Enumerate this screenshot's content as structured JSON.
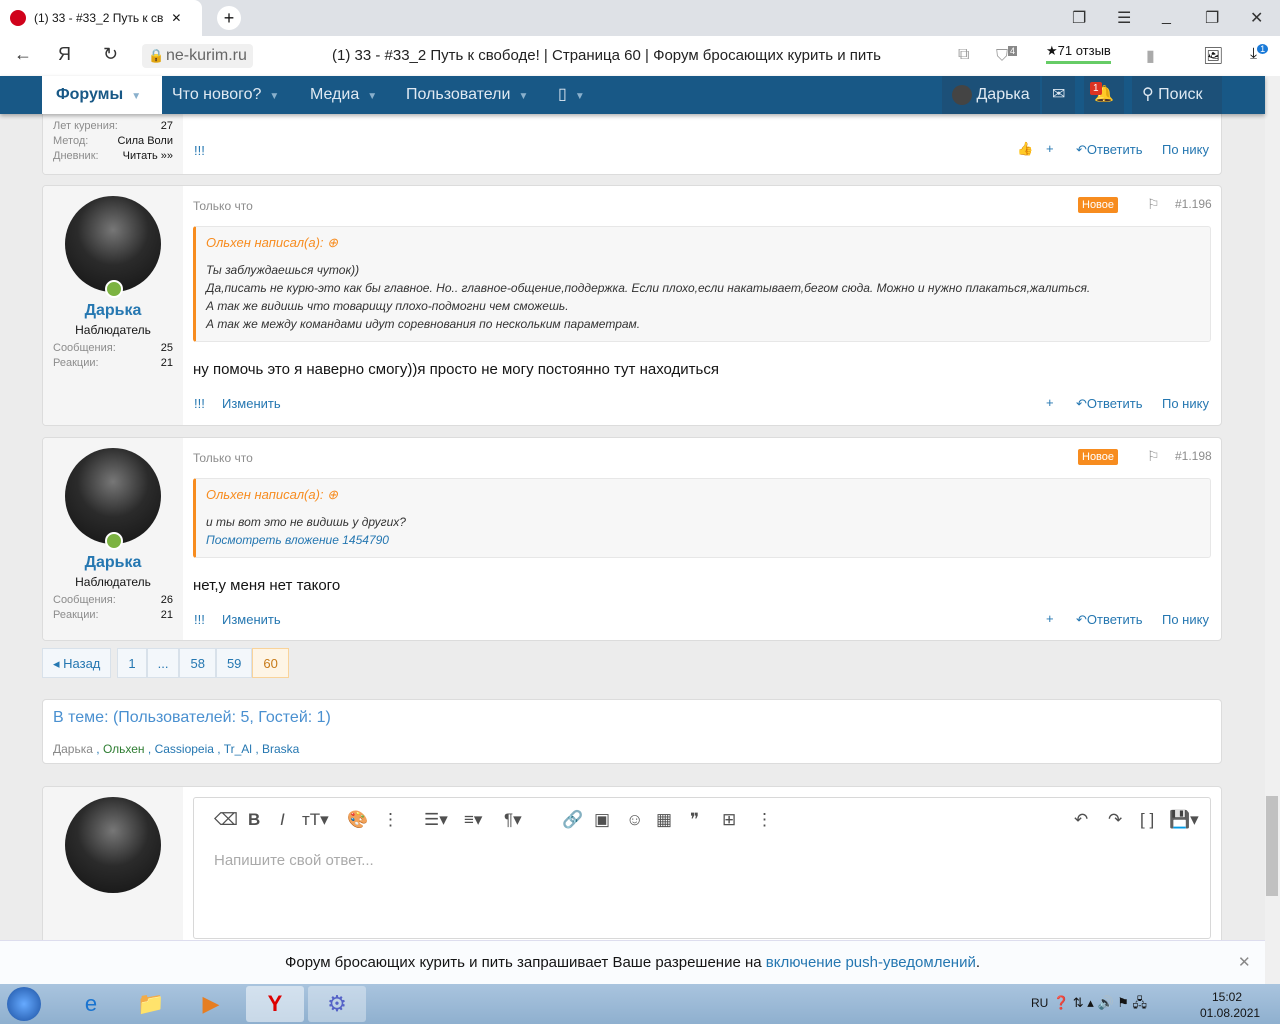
{
  "browser": {
    "tab_title": "(1) 33 - #33_2 Путь к св",
    "host": "ne-kurim.ru",
    "page_title": "(1) 33 - #33_2 Путь к свободе! | Страница 60 | Форум бросающих курить и пить",
    "reviews": "★71 отзыв",
    "shield_badge": "4",
    "download_badge": "1"
  },
  "nav": {
    "items": [
      "Форумы",
      "Что нового?",
      "Медиа",
      "Пользователи",
      "▯"
    ],
    "user": "Дарька",
    "alerts_badge": "1",
    "search": "Поиск"
  },
  "prev_post": {
    "stats": [
      [
        "Лет курения:",
        "27"
      ],
      [
        "Метод:",
        "Сила Воли"
      ],
      [
        "Дневник:",
        "Читать »»"
      ]
    ],
    "bang": "!!!"
  },
  "actions": {
    "plus": "+",
    "reply": "Ответить",
    "by_nick": "По нику",
    "edit": "Изменить",
    "bang": "!!!"
  },
  "posts": [
    {
      "time": "Только что",
      "badge": "Новое",
      "number": "#1.196",
      "user": "Дарька",
      "title": "Наблюдатель",
      "messages_label": "Сообщения:",
      "messages": "25",
      "reactions_label": "Реакции:",
      "reactions": "21",
      "quote_author": "Ольхен написал(а):",
      "quote_lines": [
        "Ты заблуждаешься чуток))",
        "Да,писать не курю-это как бы главное. Но.. главное-общение,поддержка. Если плохо,если накатывает,бегом сюда. Можно и нужно плакаться,жалиться.",
        "А так же видишь что товарищу плохо-подмогни чем сможешь.",
        "А так же между командами идут соревнования по нескольким параметрам."
      ],
      "body": "ну помочь это я наверно смогу))я просто не могу постоянно тут находиться"
    },
    {
      "time": "Только что",
      "badge": "Новое",
      "number": "#1.198",
      "user": "Дарька",
      "title": "Наблюдатель",
      "messages_label": "Сообщения:",
      "messages": "26",
      "reactions_label": "Реакции:",
      "reactions": "21",
      "quote_author": "Ольхен написал(а):",
      "quote_lines": [
        "и ты вот это не видишь у других?"
      ],
      "quote_link": "Посмотреть вложение 1454790",
      "body": "нет,у меня нет такого"
    }
  ],
  "pager": {
    "prev": "◂ Назад",
    "pages": [
      "1",
      "...",
      "58",
      "59",
      "60"
    ],
    "current": "60"
  },
  "online": {
    "title": "В теме: (Пользователей: 5, Гостей: 1)",
    "users": [
      "Дарька",
      "Ольхен",
      "Cassiopeia",
      "Tr_Al",
      "Braska"
    ]
  },
  "editor": {
    "placeholder": "Напишите свой ответ..."
  },
  "push": {
    "text": "Форум бросающих курить и пить запрашивает Ваше разрешение на ",
    "link": "включение push-уведомлений",
    "end": "."
  },
  "taskbar": {
    "lang": "RU",
    "time": "15:02",
    "date": "01.08.2021"
  },
  "colors": {
    "nav": "#185886",
    "accent": "#f78c1f",
    "link": "#2577b1"
  }
}
